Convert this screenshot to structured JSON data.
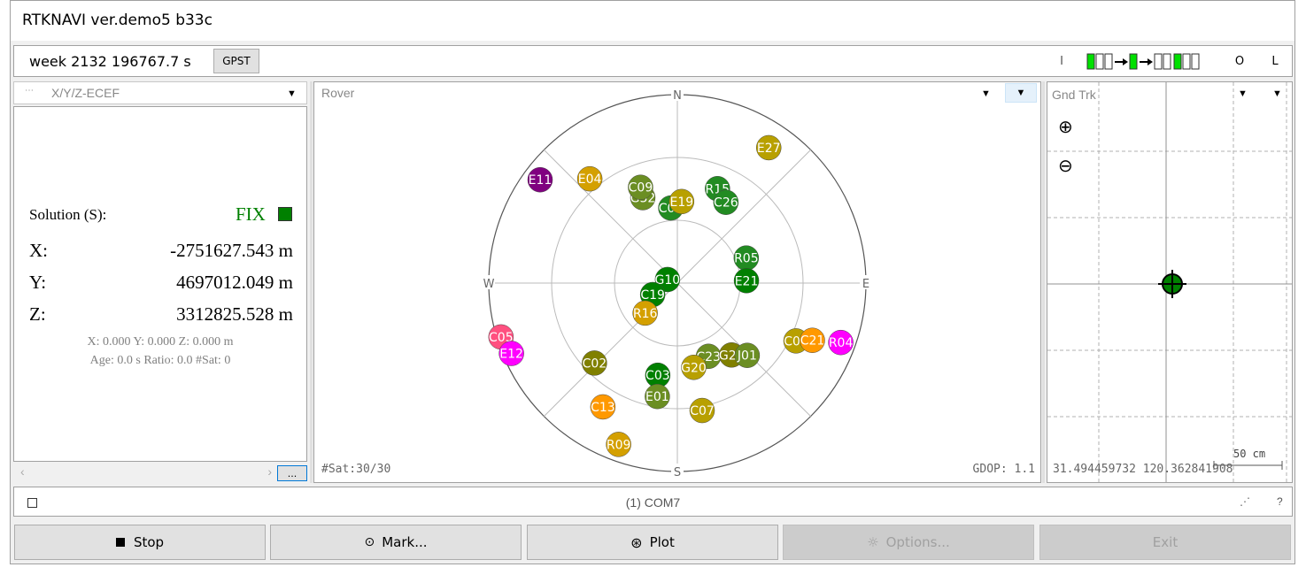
{
  "window": {
    "title": "RTKNAVI ver.demo5 b33c"
  },
  "toolbar": {
    "time": "week 2132 196767.7 s",
    "time_sys_button": "GPST",
    "input_label": "I",
    "output_label": "O",
    "log_label": "L"
  },
  "solution_panel": {
    "format": "X/Y/Z-ECEF",
    "solution_label": "Solution (S):",
    "status": "FIX",
    "status_color": "#008000",
    "x_label": "X:",
    "x_value": "-2751627.543 m",
    "y_label": "Y:",
    "y_value": "4697012.049 m",
    "z_label": "Z:",
    "z_value": "3312825.528 m",
    "std_line": "X: 0.000 Y: 0.000 Z: 0.000 m",
    "age_line": "Age: 0.0 s Ratio: 0.0 #Sat: 0",
    "more_button": "..."
  },
  "skyplot": {
    "title": "Rover",
    "north": "N",
    "south": "S",
    "east": "E",
    "west": "W",
    "sat_count": "#Sat:30/30",
    "gdop": "GDOP: 1.1",
    "satellites": [
      {
        "id": "E11",
        "az": -53,
        "el": 8,
        "color": "#800080"
      },
      {
        "id": "E04",
        "az": -40,
        "el": 25,
        "color": "#d4a000"
      },
      {
        "id": "G32",
        "az": -22,
        "el": 46,
        "color": "#6b8e23"
      },
      {
        "id": "C09",
        "az": -21,
        "el": 41,
        "color": "#6b8e23"
      },
      {
        "id": "C06",
        "az": -5,
        "el": 54,
        "color": "#228b22"
      },
      {
        "id": "E19",
        "az": 3,
        "el": 51,
        "color": "#b8a000"
      },
      {
        "id": "R15",
        "az": 23,
        "el": 41,
        "color": "#228b22"
      },
      {
        "id": "C26",
        "az": 31,
        "el": 45,
        "color": "#228b22"
      },
      {
        "id": "E27",
        "az": 34,
        "el": 12,
        "color": "#b8a000"
      },
      {
        "id": "R05",
        "az": 70,
        "el": 55,
        "color": "#228b22"
      },
      {
        "id": "E21",
        "az": 88,
        "el": 57,
        "color": "#008000"
      },
      {
        "id": "G10",
        "az": -70,
        "el": 85,
        "color": "#008000"
      },
      {
        "id": "C19",
        "az": -115,
        "el": 77,
        "color": "#008000"
      },
      {
        "id": "R16",
        "az": -133,
        "el": 69,
        "color": "#d4a000"
      },
      {
        "id": "C05",
        "az": -107,
        "el": 2,
        "color": "#ff5080"
      },
      {
        "id": "E12",
        "az": -113,
        "el": 4,
        "color": "#ff00ff"
      },
      {
        "id": "C02",
        "az": -134,
        "el": 35,
        "color": "#808000"
      },
      {
        "id": "C13",
        "az": -149,
        "el": 21,
        "color": "#ff9900"
      },
      {
        "id": "C03",
        "az": -168,
        "el": 45,
        "color": "#008000"
      },
      {
        "id": "E01",
        "az": -170,
        "el": 35,
        "color": "#6b8e23"
      },
      {
        "id": "R09",
        "az": -160,
        "el": 8,
        "color": "#d4a000"
      },
      {
        "id": "C23",
        "az": 157,
        "el": 52,
        "color": "#6b8e23"
      },
      {
        "id": "G20",
        "az": 169,
        "el": 49,
        "color": "#b8a000"
      },
      {
        "id": "G25",
        "az": 143,
        "el": 47,
        "color": "#808000"
      },
      {
        "id": "J01",
        "az": 136,
        "el": 42,
        "color": "#6b8e23"
      },
      {
        "id": "C07",
        "az": 169,
        "el": 28,
        "color": "#b8a000"
      },
      {
        "id": "C04",
        "az": 116,
        "el": 27,
        "color": "#b8a000"
      },
      {
        "id": "C21",
        "az": 113,
        "el": 20,
        "color": "#ff9900"
      },
      {
        "id": "R04",
        "az": 110,
        "el": 7,
        "color": "#ff00ff"
      }
    ]
  },
  "track_panel": {
    "title": "Gnd Trk",
    "coords": "31.494459732 120.362841908",
    "scale": "50 cm"
  },
  "statusbar": {
    "port": "(1) COM7",
    "help": "?"
  },
  "buttons": {
    "stop": "Stop",
    "mark": "Mark...",
    "plot": "Plot",
    "options": "Options...",
    "exit": "Exit"
  }
}
